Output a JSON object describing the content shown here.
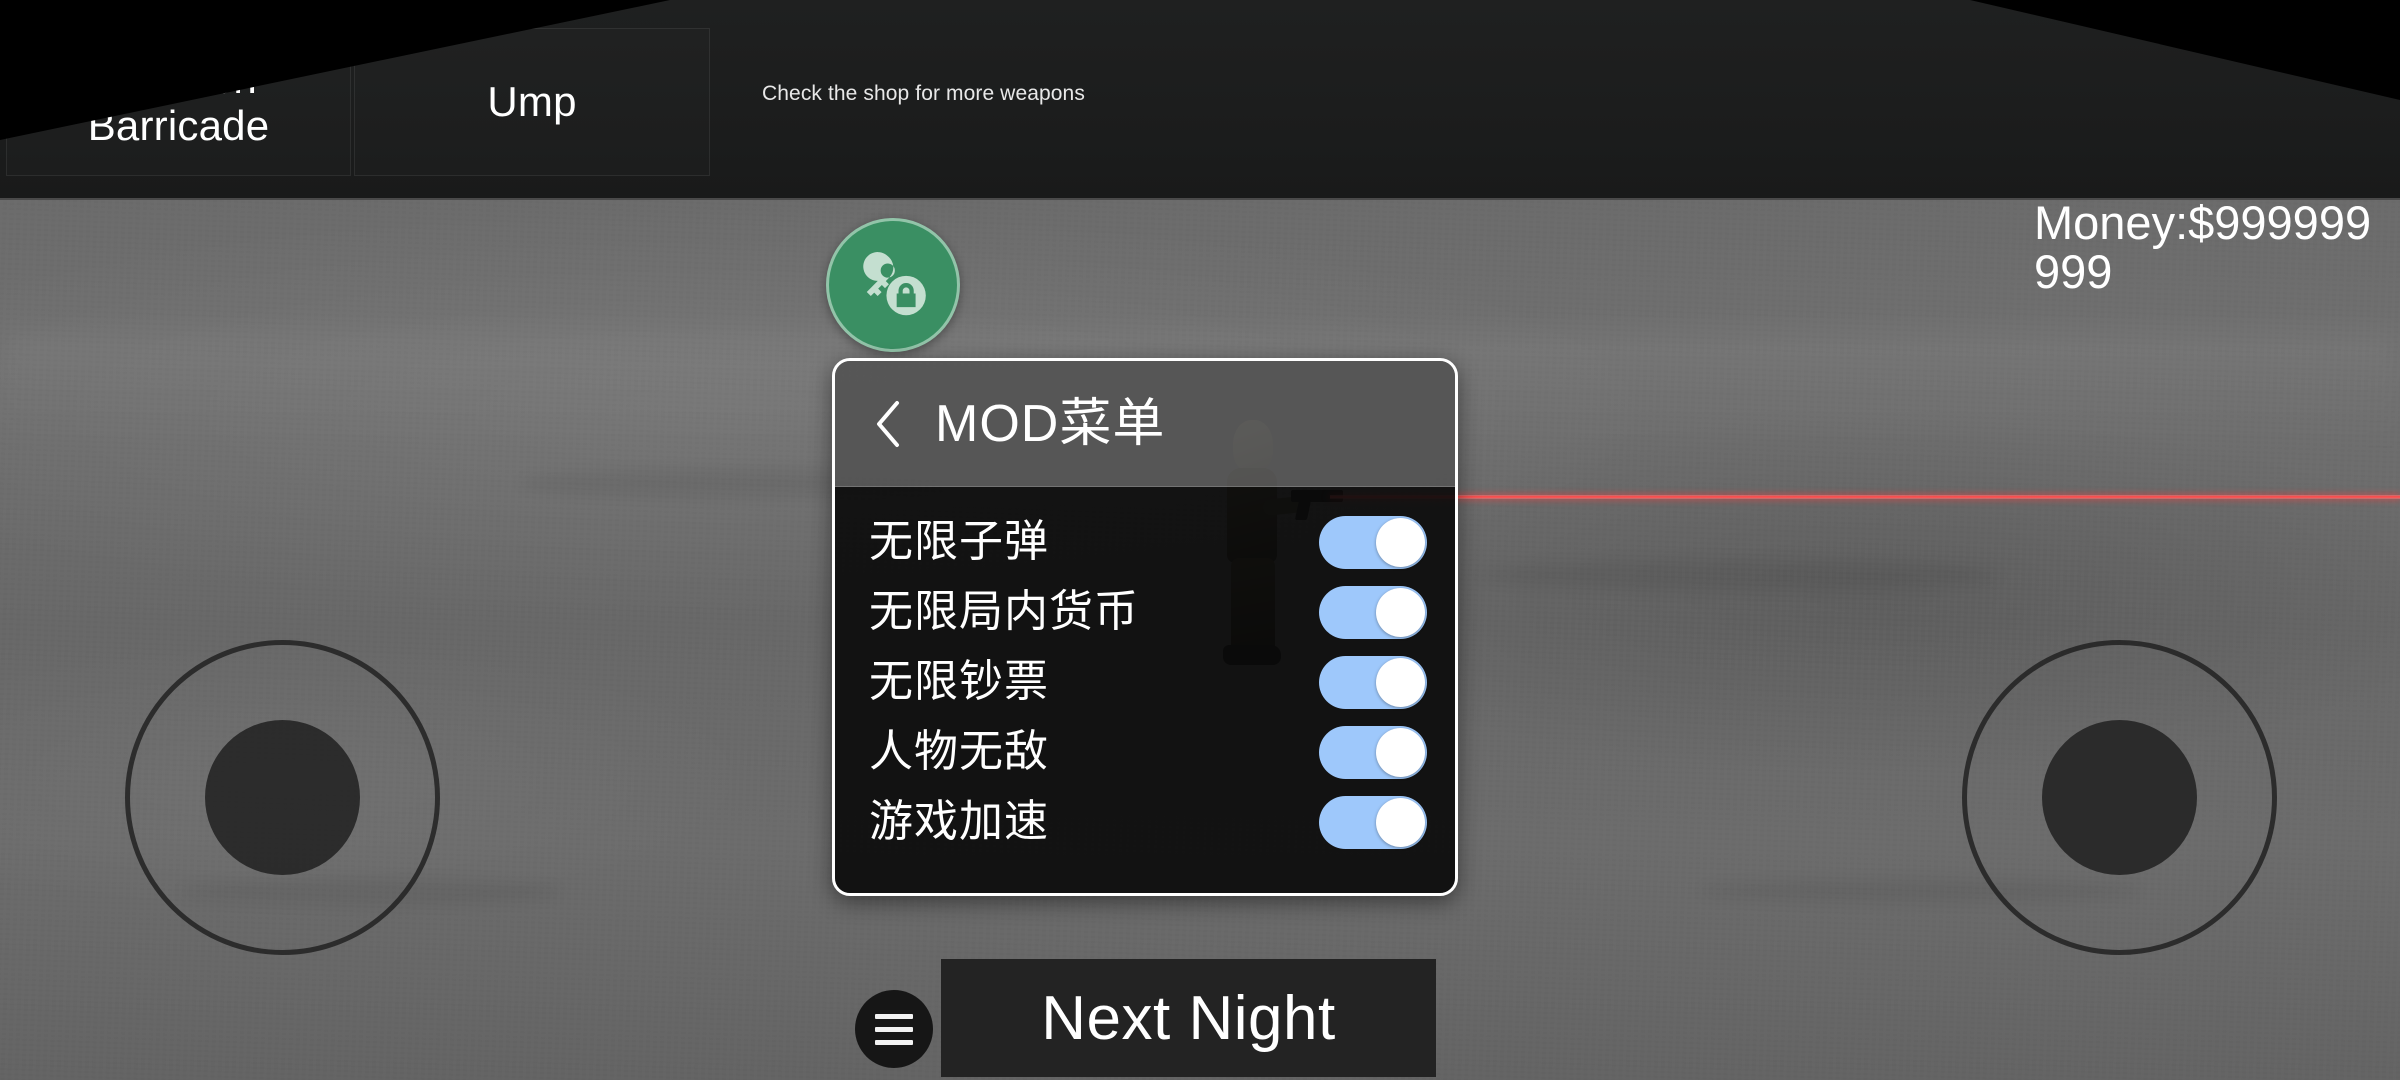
{
  "hud": {
    "item_slots": [
      {
        "label": "Wooden Barricade"
      },
      {
        "label": "Ump"
      }
    ],
    "shop_hint": "Check the shop for more weapons",
    "money": "Money:$999999999"
  },
  "mod_launcher": {
    "icon": "key-lock-icon",
    "color": "#3a8f63"
  },
  "mod_panel": {
    "back_icon": "chevron-left-icon",
    "title": "MOD菜单",
    "accent_on_color": "#9ec8fb",
    "rows": [
      {
        "label": "无限子弹",
        "enabled": true
      },
      {
        "label": "无限局内货币",
        "enabled": true
      },
      {
        "label": "无限钞票",
        "enabled": true
      },
      {
        "label": "人物无敌",
        "enabled": true
      },
      {
        "label": "游戏加速",
        "enabled": true
      }
    ]
  },
  "controls": {
    "menu_icon": "hamburger-icon",
    "next_night_label": "Next Night",
    "left_joystick": "move-joystick",
    "right_joystick": "aim-joystick"
  },
  "effects": {
    "laser_color": "#ff4747"
  }
}
